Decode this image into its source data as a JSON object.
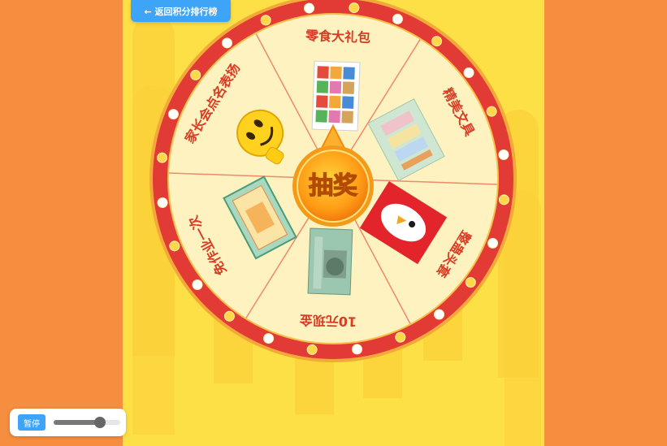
{
  "back_button": {
    "label": "← 返回积分排行榜"
  },
  "wheel": {
    "center_label": "抽奖",
    "prizes": [
      {
        "label": "零食大礼包",
        "image": "snack-bag-photo"
      },
      {
        "label": "精美文具",
        "image": "stationery-photo"
      },
      {
        "label": "整蛊头套",
        "image": "chicken-hood-photo"
      },
      {
        "label": "10元现金",
        "image": "ten-yuan-banknote"
      },
      {
        "label": "免作业一次",
        "image": "homework-pass-stamp"
      },
      {
        "label": "家长会点名表扬",
        "image": "thumbs-up-emoji"
      }
    ]
  },
  "audio_controls": {
    "pause_label": "暂停",
    "volume": 0.7
  },
  "colors": {
    "background": "#f58e3f",
    "stage": "#fde046",
    "wheel_rim": "#e23a34",
    "wheel_face": "#fdf2c0",
    "prize_text": "#d83c25",
    "button": "#3da4f8"
  }
}
